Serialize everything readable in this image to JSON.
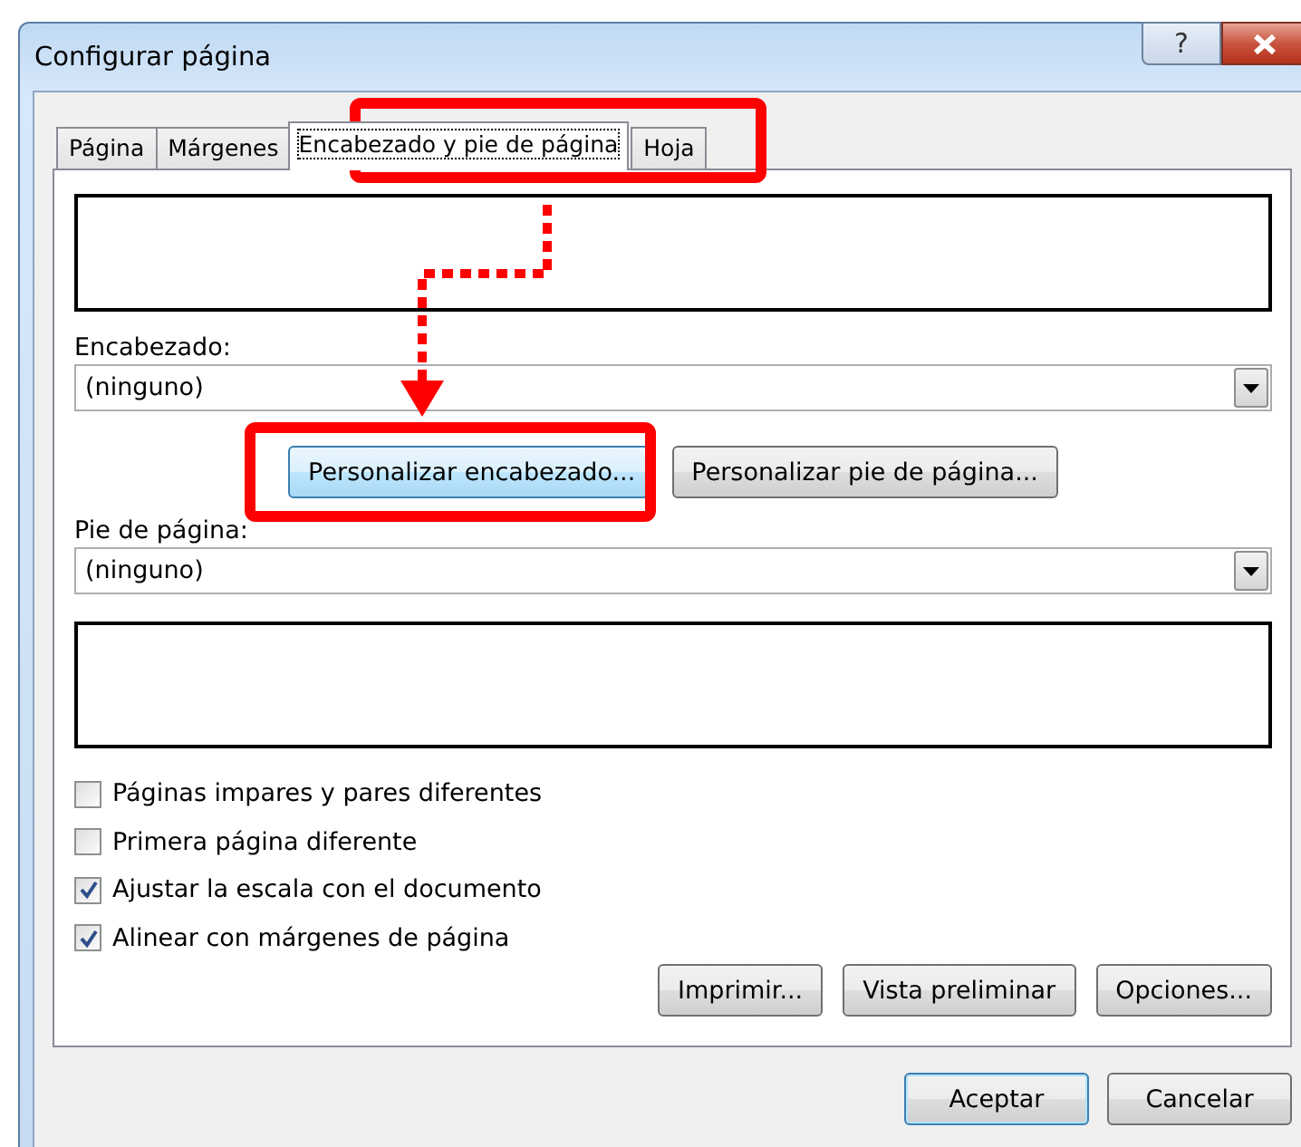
{
  "window": {
    "title": "Configurar página",
    "help_button": "?"
  },
  "tabs": [
    {
      "label": "Página",
      "selected": false
    },
    {
      "label": "Márgenes",
      "selected": false
    },
    {
      "label": "Encabezado y pie de página",
      "selected": true
    },
    {
      "label": "Hoja",
      "selected": false
    }
  ],
  "header": {
    "label": "Encabezado:",
    "value": "(ninguno)"
  },
  "custom_buttons": [
    {
      "label": "Personalizar encabezado...",
      "focused": true
    },
    {
      "label": "Personalizar pie de página...",
      "focused": false
    }
  ],
  "footer": {
    "label": "Pie de página:",
    "value": "(ninguno)"
  },
  "options": [
    {
      "label": "Páginas impares y pares diferentes",
      "checked": false
    },
    {
      "label": "Primera página diferente",
      "checked": false
    },
    {
      "label": "Ajustar la escala con el documento",
      "checked": true
    },
    {
      "label": "Alinear con márgenes de página",
      "checked": true
    }
  ],
  "panel_buttons": [
    "Imprimir...",
    "Vista preliminar",
    "Opciones..."
  ],
  "dialog_buttons": [
    {
      "label": "Aceptar",
      "default": true
    },
    {
      "label": "Cancelar",
      "default": false
    }
  ]
}
